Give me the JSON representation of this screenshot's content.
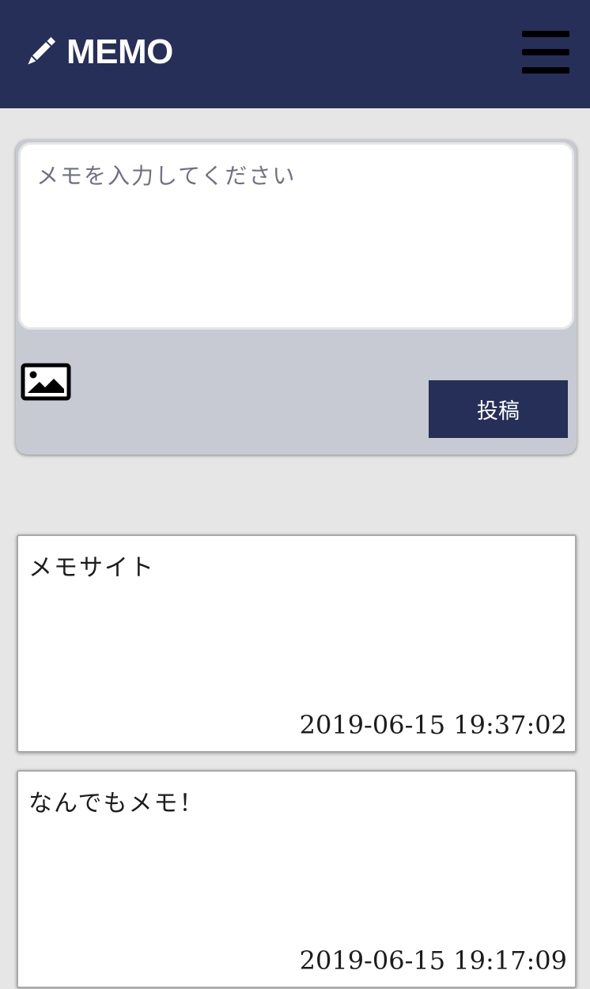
{
  "header": {
    "title": "MEMO",
    "logo_icon": "pencil-icon",
    "menu_icon": "hamburger-menu-icon",
    "background": "#262f58"
  },
  "composer": {
    "placeholder": "メモを入力してください",
    "value": "",
    "image_icon": "image-icon",
    "post_label": "投稿"
  },
  "memos": [
    {
      "text": "メモサイト",
      "date": "2019-06-15 19:37:02"
    },
    {
      "text": "なんでもメモ！",
      "date": "2019-06-15 19:17:09"
    }
  ]
}
